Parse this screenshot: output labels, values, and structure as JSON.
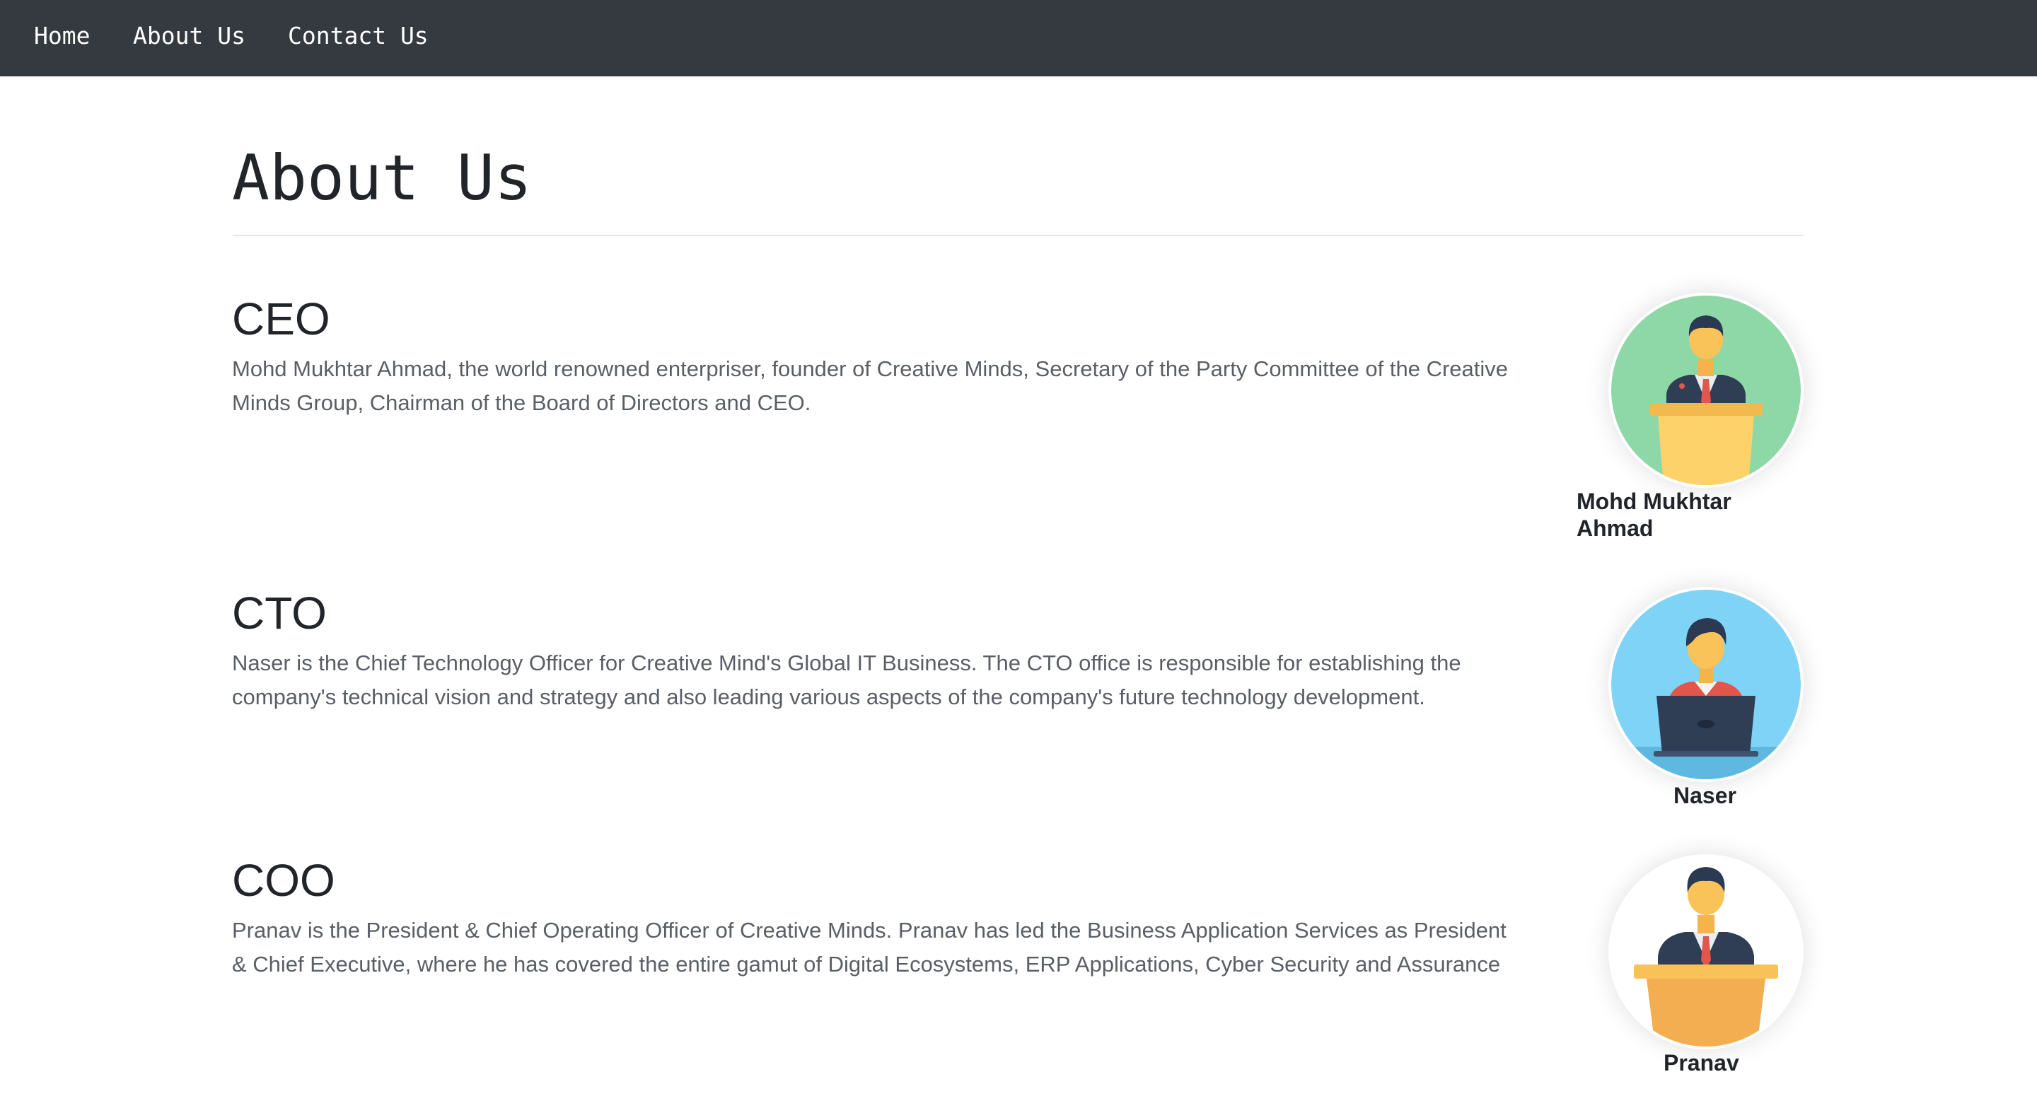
{
  "nav": {
    "items": [
      "Home",
      "About Us",
      "Contact Us"
    ]
  },
  "page": {
    "title": "About Us"
  },
  "team": [
    {
      "role": "CEO",
      "description": "Mohd Mukhtar Ahmad, the world renowned enterpriser, founder of Creative Minds, Secretary of the Party Committee of the Creative Minds Group, Chairman of the Board of Directors and CEO.",
      "name": "Mohd Mukhtar Ahmad",
      "avatar_icon": "speaker-at-podium-icon",
      "avatar_bg": "#8ed8a7"
    },
    {
      "role": "CTO",
      "description": "Naser is the Chief Technology Officer for Creative Mind's Global IT Business. The CTO office is responsible for establishing the company's technical vision and strategy and also leading various aspects of the company's future technology development.",
      "name": "Naser",
      "avatar_icon": "person-with-laptop-icon",
      "avatar_bg": "#7fd3f7"
    },
    {
      "role": "COO",
      "description": "Pranav is the President & Chief Operating Officer of Creative Minds. Pranav has led the Business Application Services as President & Chief Executive, where he has covered the entire gamut of Digital Ecosystems, ERP Applications, Cyber Security and Assurance",
      "name": "Pranav",
      "avatar_icon": "presenter-at-podium-icon",
      "avatar_bg": "#ffffff"
    }
  ]
}
